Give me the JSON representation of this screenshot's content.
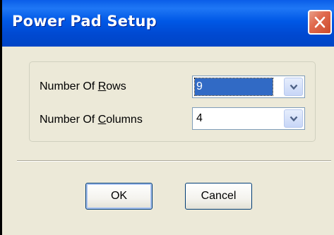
{
  "window": {
    "title": "Power Pad Setup"
  },
  "form": {
    "rows_label_pre": "Number Of ",
    "rows_label_key": "R",
    "rows_label_post": "ows",
    "rows_value": "9",
    "columns_label_pre": "Number Of ",
    "columns_label_key": "C",
    "columns_label_post": "olumns",
    "columns_value": "4"
  },
  "buttons": {
    "ok": "OK",
    "cancel": "Cancel"
  },
  "colors": {
    "titlebar": "#0058e6",
    "close": "#e06a4e",
    "selection": "#316ac5",
    "face": "#ece9d8"
  }
}
